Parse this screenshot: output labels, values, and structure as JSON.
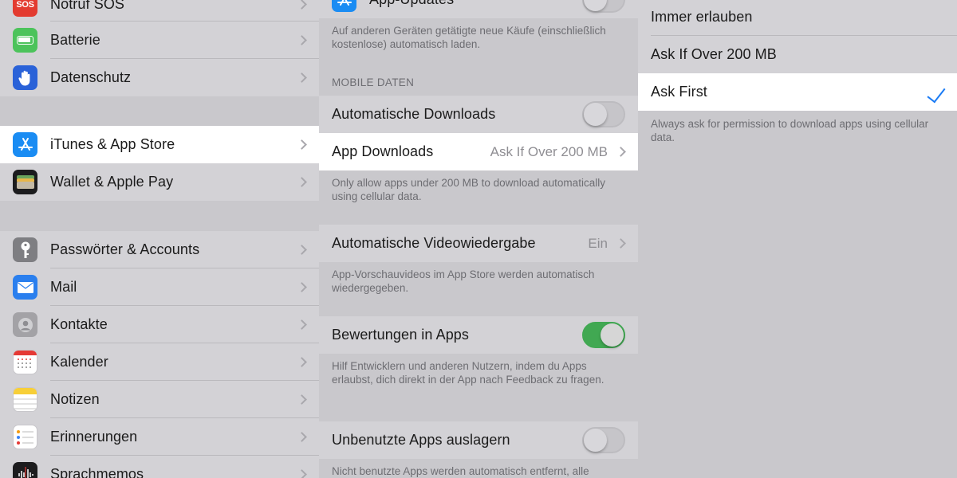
{
  "settings_list": {
    "items": [
      {
        "id": "notruf",
        "label": "Notruf SOS",
        "icon": "sos-icon",
        "icon_text": "SOS",
        "color": "#e33b30"
      },
      {
        "id": "batterie",
        "label": "Batterie",
        "icon": "battery-icon",
        "color": "#4cc35b"
      },
      {
        "id": "datenschutz",
        "label": "Datenschutz",
        "icon": "hand-icon",
        "color": "#2a62d8"
      },
      {
        "id": "itunes",
        "label": "iTunes & App Store",
        "icon": "app-store-icon",
        "color": "#1a8cf3"
      },
      {
        "id": "wallet",
        "label": "Wallet & Apple Pay",
        "icon": "wallet-icon",
        "color": "#1c1c1e"
      },
      {
        "id": "passwoerter",
        "label": "Passwörter & Accounts",
        "icon": "key-icon",
        "color": "#7e7e82"
      },
      {
        "id": "mail",
        "label": "Mail",
        "icon": "mail-icon",
        "color": "#2a7fee"
      },
      {
        "id": "kontakte",
        "label": "Kontakte",
        "icon": "contacts-icon",
        "color": "#a3a2a6"
      },
      {
        "id": "kalender",
        "label": "Kalender",
        "icon": "calendar-icon",
        "color": "#ffffff"
      },
      {
        "id": "notizen",
        "label": "Notizen",
        "icon": "notes-icon",
        "color": "#f7cf38"
      },
      {
        "id": "erinnerungen",
        "label": "Erinnerungen",
        "icon": "reminders-icon",
        "color": "#ffffff"
      },
      {
        "id": "sprachmemos",
        "label": "Sprachmemos",
        "icon": "voice-memos-icon",
        "color": "#1c1c1e"
      }
    ]
  },
  "store_settings": {
    "app_updates": {
      "label": "App-Updates",
      "on": false
    },
    "auto_footer": "Auf anderen Geräten getätigte neue Käufe (einschließlich kostenlose) automatisch laden.",
    "mobile_header": "MOBILE DATEN",
    "auto_downloads": {
      "label": "Automatische Downloads",
      "on": false
    },
    "app_downloads": {
      "label": "App Downloads",
      "value": "Ask If Over 200 MB"
    },
    "app_downloads_footer": "Only allow apps under 200 MB to download automatically using cellular data.",
    "video": {
      "label": "Automatische Videowiedergabe",
      "value": "Ein"
    },
    "video_footer": "App-Vorschauvideos im App Store werden automatisch wiedergegeben.",
    "ratings": {
      "label": "Bewertungen in Apps",
      "on": true
    },
    "ratings_footer": "Hilf Entwicklern und anderen Nutzern, indem du Apps erlaubst, dich direkt in der App nach Feedback zu fragen.",
    "offload": {
      "label": "Unbenutzte Apps auslagern",
      "on": false
    },
    "offload_footer": "Nicht benutzte Apps werden automatisch entfernt, alle"
  },
  "download_options": {
    "options": [
      {
        "label": "Immer erlauben",
        "selected": false
      },
      {
        "label": "Ask If Over 200 MB",
        "selected": false
      },
      {
        "label": "Ask First",
        "selected": true
      }
    ],
    "footer": "Always ask for permission to download apps using cellular data."
  },
  "colors": {
    "accent": "#1a7bf5",
    "toggle_on": "#41a852"
  }
}
